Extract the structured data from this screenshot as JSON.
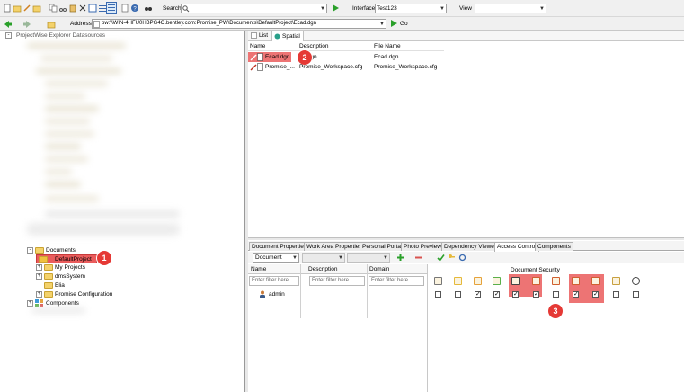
{
  "toolbar": {
    "search_label": "Search",
    "interface_label": "Interface",
    "interface_value": "Test123",
    "view_label": "View",
    "view_value": ""
  },
  "address": {
    "label": "Address",
    "value": "pw:\\\\WIN-4HFU0HBPG4O.bentley.com:Promise_PW\\Documents\\DefaultProject\\Ecad.dgn",
    "go_label": "Go"
  },
  "tree": {
    "root_label": "ProjectWise Explorer Datasources",
    "documents": "Documents",
    "default_project": "DefaultProject",
    "my_projects": "My Projects",
    "dms_system": "dmsSystem",
    "elia": "Elia",
    "promise_config": "Promise Configuration",
    "components": "Components"
  },
  "view_tabs": [
    "List",
    "Spatial"
  ],
  "doc_list": {
    "columns": [
      "Name",
      "Description",
      "File Name"
    ],
    "rows": [
      {
        "name": "Ecad.dgn",
        "description": ".dgn",
        "file_name": "Ecad.dgn"
      },
      {
        "name": "Promise_...",
        "description": "Promise_Workspace.cfg",
        "file_name": "Promise_Workspace.cfg"
      }
    ]
  },
  "prop_tabs": [
    "Document Properties",
    "Work Area Properties",
    "Personal Portal",
    "Photo Preview",
    "Dependency Viewer",
    "Access Control",
    "Components"
  ],
  "access": {
    "type_value": "Document",
    "columns": [
      "Name",
      "Description",
      "Domain"
    ],
    "filter_placeholder": "Enter filter here",
    "security_header": "Document Security",
    "user": "admin",
    "checks": [
      false,
      false,
      true,
      true,
      true,
      true,
      false,
      true,
      true,
      false,
      false
    ]
  },
  "badges": [
    "1",
    "2",
    "3"
  ],
  "colors": {
    "highlight": "#ea5c5c",
    "selection": "#cce8ff",
    "badge": "#e53935"
  }
}
